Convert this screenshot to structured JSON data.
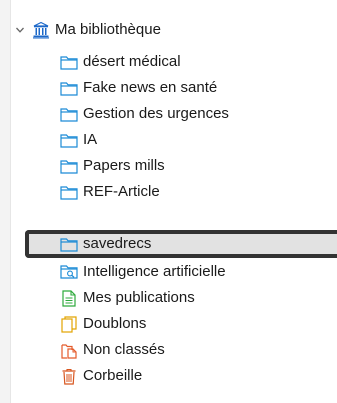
{
  "library": {
    "title": "Ma bibliothèque",
    "icon": "library-building-icon",
    "expanded": true
  },
  "collections": [
    {
      "label": "désert médical",
      "icon": "folder-icon"
    },
    {
      "label": "Fake news en santé",
      "icon": "folder-icon"
    },
    {
      "label": "Gestion des urgences",
      "icon": "folder-icon"
    },
    {
      "label": "IA",
      "icon": "folder-icon"
    },
    {
      "label": "Papers mills",
      "icon": "folder-icon"
    },
    {
      "label": "REF-Article",
      "icon": "folder-icon"
    },
    {
      "label": "savedrecs",
      "icon": "folder-icon",
      "selected": true
    }
  ],
  "special_items": [
    {
      "label": "Intelligence artificielle",
      "icon": "saved-search-folder-icon"
    },
    {
      "label": "Mes publications",
      "icon": "document-icon"
    },
    {
      "label": "Doublons",
      "icon": "duplicates-icon"
    },
    {
      "label": "Non classés",
      "icon": "unfiled-icon"
    },
    {
      "label": "Corbeille",
      "icon": "trash-icon"
    }
  ],
  "colors": {
    "folder_stroke": "#1c8bd6",
    "library_icon": "#1c68c9",
    "document_icon": "#2eaa3c",
    "duplicates_icon": "#e2a400",
    "unfiled_icon": "#e45b2b",
    "trash_icon": "#d8561f",
    "selection_border": "#333333",
    "selection_bg": "#e2e2e2"
  }
}
